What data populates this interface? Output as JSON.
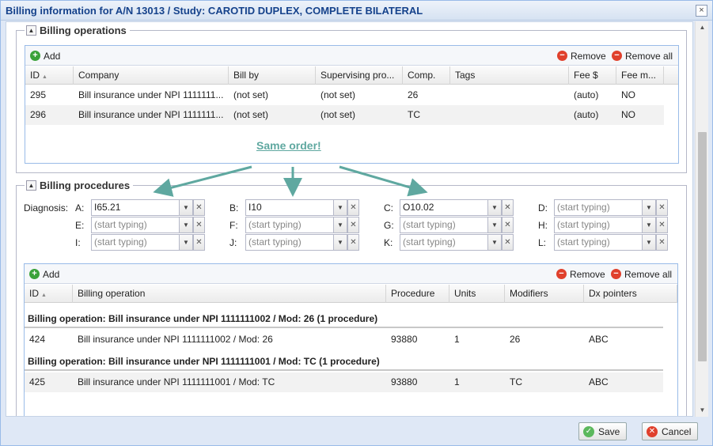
{
  "window": {
    "title": "Billing information for A/N 13013 / Study: CAROTID DUPLEX, COMPLETE BILATERAL",
    "close_icon": "×"
  },
  "billing_operations": {
    "title": "Billing operations",
    "toolbar": {
      "add": "Add",
      "remove": "Remove",
      "remove_all": "Remove all"
    },
    "columns": [
      "ID",
      "Company",
      "Bill by",
      "Supervising pro...",
      "Comp.",
      "Tags",
      "Fee $",
      "Fee m..."
    ],
    "rows": [
      {
        "id": "295",
        "company": "Bill insurance under NPI 1111111...",
        "bill_by": "(not set)",
        "supervising": "(not set)",
        "comp": "26",
        "tags": "",
        "fee": "(auto)",
        "fee_m": "NO"
      },
      {
        "id": "296",
        "company": "Bill insurance under NPI 1111111...",
        "bill_by": "(not set)",
        "supervising": "(not set)",
        "comp": "TC",
        "tags": "",
        "fee": "(auto)",
        "fee_m": "NO"
      }
    ]
  },
  "annotation": {
    "text": "Same order!",
    "color": "#5fa8a0"
  },
  "billing_procedures": {
    "title": "Billing procedures",
    "diagnosis_label": "Diagnosis:",
    "diagnosis": [
      {
        "key": "A:",
        "value": "I65.21",
        "placeholder": false
      },
      {
        "key": "B:",
        "value": "I10",
        "placeholder": false
      },
      {
        "key": "C:",
        "value": "O10.02",
        "placeholder": false
      },
      {
        "key": "D:",
        "value": "(start typing)",
        "placeholder": true
      },
      {
        "key": "E:",
        "value": "(start typing)",
        "placeholder": true
      },
      {
        "key": "F:",
        "value": "(start typing)",
        "placeholder": true
      },
      {
        "key": "G:",
        "value": "(start typing)",
        "placeholder": true
      },
      {
        "key": "H:",
        "value": "(start typing)",
        "placeholder": true
      },
      {
        "key": "I:",
        "value": "(start typing)",
        "placeholder": true
      },
      {
        "key": "J:",
        "value": "(start typing)",
        "placeholder": true
      },
      {
        "key": "K:",
        "value": "(start typing)",
        "placeholder": true
      },
      {
        "key": "L:",
        "value": "(start typing)",
        "placeholder": true
      }
    ],
    "toolbar": {
      "add": "Add",
      "remove": "Remove",
      "remove_all": "Remove all"
    },
    "columns": [
      "ID",
      "Billing operation",
      "Procedure",
      "Units",
      "Modifiers",
      "Dx pointers"
    ],
    "groups": [
      {
        "header": "Billing operation: Bill insurance under NPI 1111111002 / Mod: 26 (1 procedure)",
        "row": {
          "id": "424",
          "operation": "Bill insurance under NPI 1111111002 / Mod: 26",
          "procedure": "93880",
          "units": "1",
          "modifiers": "26",
          "dx": "ABC"
        }
      },
      {
        "header": "Billing operation: Bill insurance under NPI 1111111001 / Mod: TC (1 procedure)",
        "row": {
          "id": "425",
          "operation": "Bill insurance under NPI 1111111001 / Mod: TC",
          "procedure": "93880",
          "units": "1",
          "modifiers": "TC",
          "dx": "ABC"
        }
      }
    ]
  },
  "footer": {
    "save": "Save",
    "cancel": "Cancel"
  },
  "colors": {
    "accent": "#15428b",
    "remove": "#e0402c",
    "add": "#3aa23a",
    "arrow": "#5fa8a0"
  }
}
